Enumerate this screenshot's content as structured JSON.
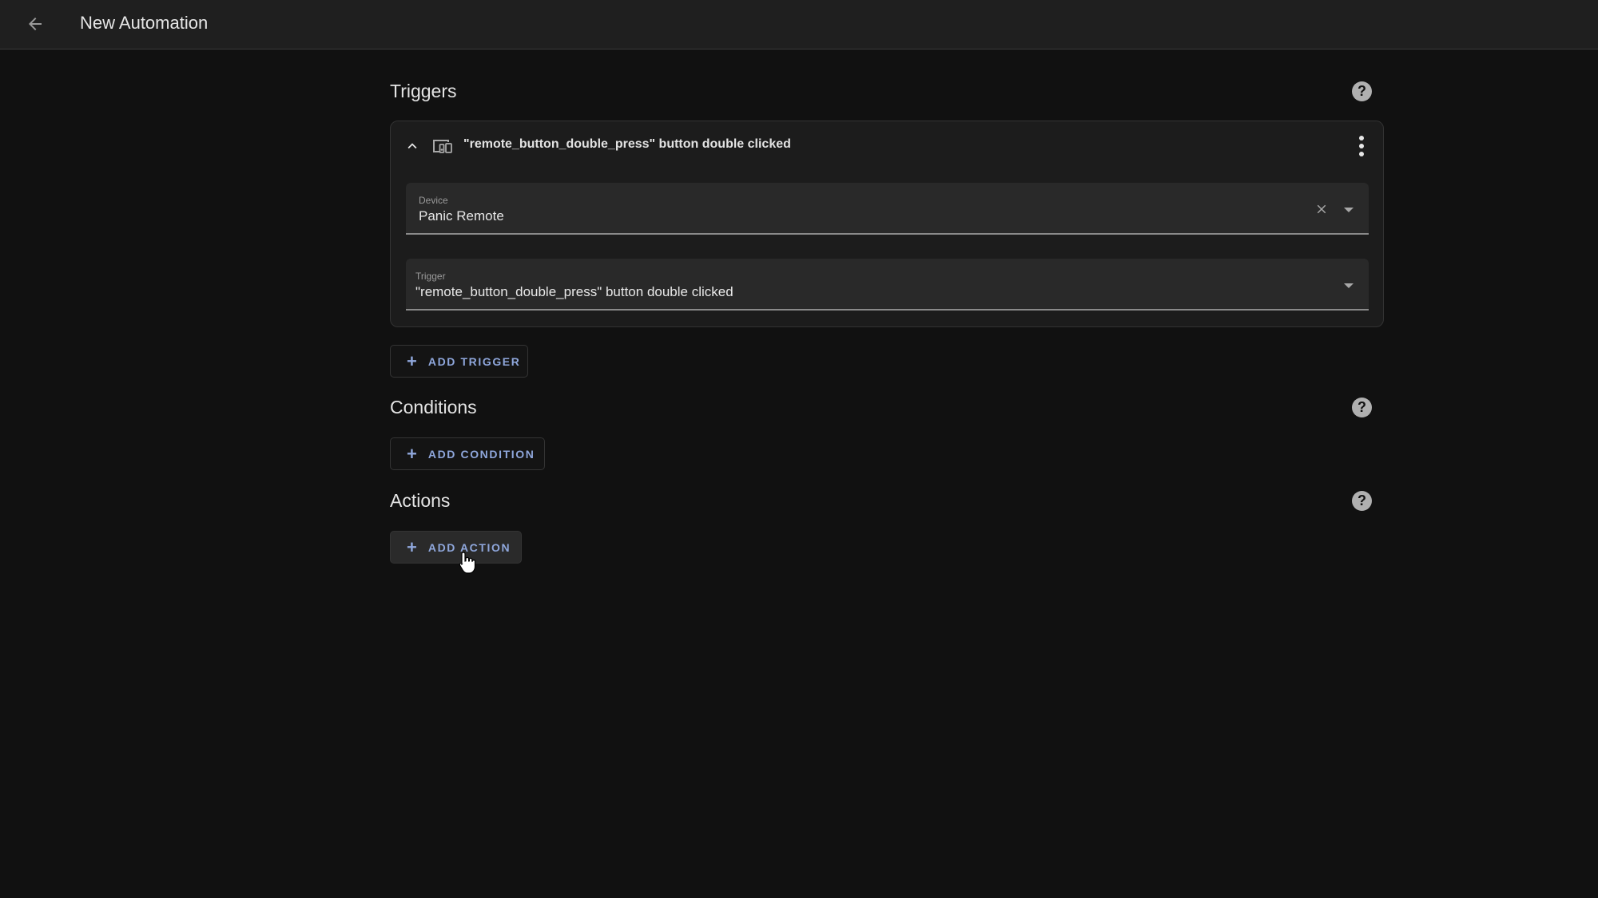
{
  "header": {
    "back_icon": "arrow-left-icon",
    "title": "New Automation"
  },
  "triggers": {
    "title": "Triggers",
    "help_icon": "help-circle-icon",
    "help_glyph": "?",
    "items": [
      {
        "title": "\"remote_button_double_press\" button double clicked",
        "collapse_icon": "chevron-up-icon",
        "type_icon": "device-icon",
        "menu_icon": "dots-vertical-icon",
        "fields": [
          {
            "label": "Device",
            "value": "Panic Remote",
            "clearable": true
          },
          {
            "label": "Trigger",
            "value": "\"remote_button_double_press\" button double clicked",
            "clearable": false
          }
        ]
      }
    ],
    "add_label": "ADD TRIGGER",
    "add_glyph": "+"
  },
  "conditions": {
    "title": "Conditions",
    "help_glyph": "?",
    "add_label": "ADD CONDITION",
    "add_glyph": "+"
  },
  "actions": {
    "title": "Actions",
    "help_glyph": "?",
    "add_label": "ADD ACTION",
    "add_glyph": "+"
  },
  "colors": {
    "accent": "#8fa7dc",
    "background": "#111111",
    "topbar": "#1f1f1f",
    "card": "#1c1c1c",
    "field": "#292929"
  }
}
